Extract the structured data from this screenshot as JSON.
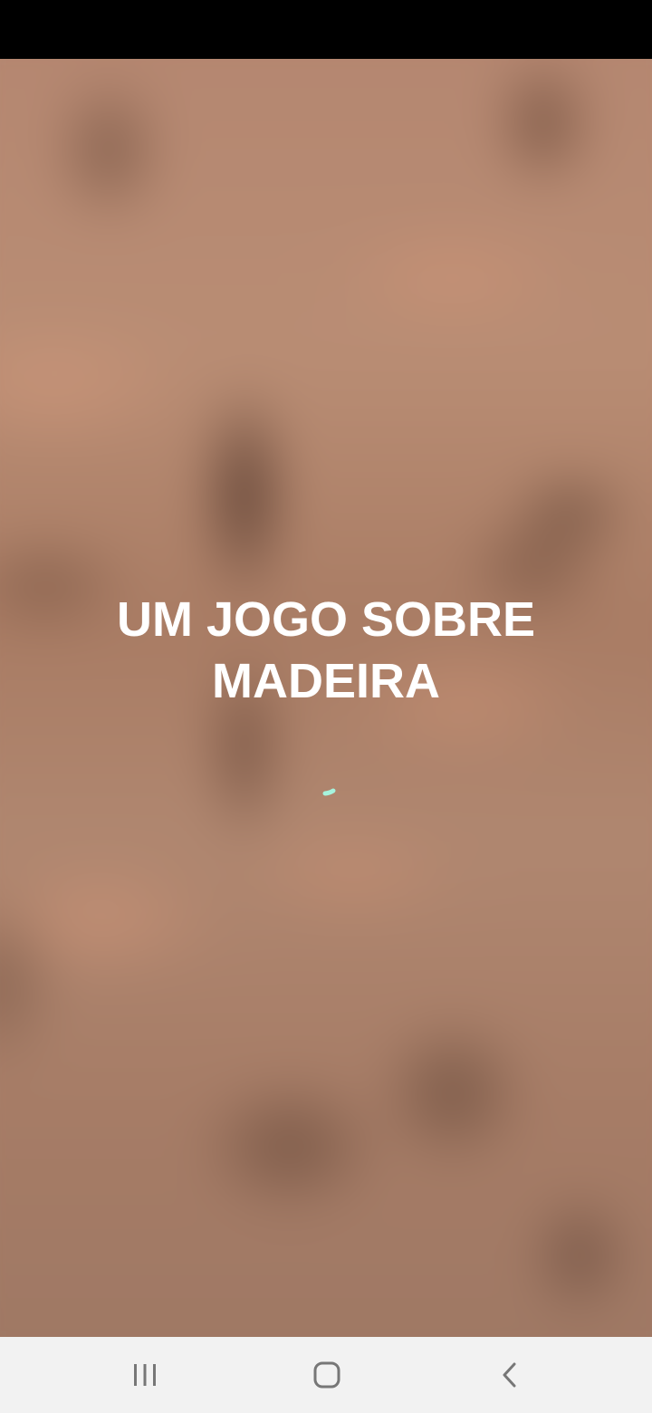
{
  "splash": {
    "title_line1": "UM JOGO SOBRE",
    "title_line2": "MADEIRA",
    "spinner_color": "#a6f3dd",
    "background_color": "#a97c63"
  },
  "navigation": {
    "recent_icon": "recent-apps-icon",
    "home_icon": "home-icon",
    "back_icon": "back-icon",
    "bar_color": "#f2f2f2",
    "icon_color": "#777777"
  }
}
